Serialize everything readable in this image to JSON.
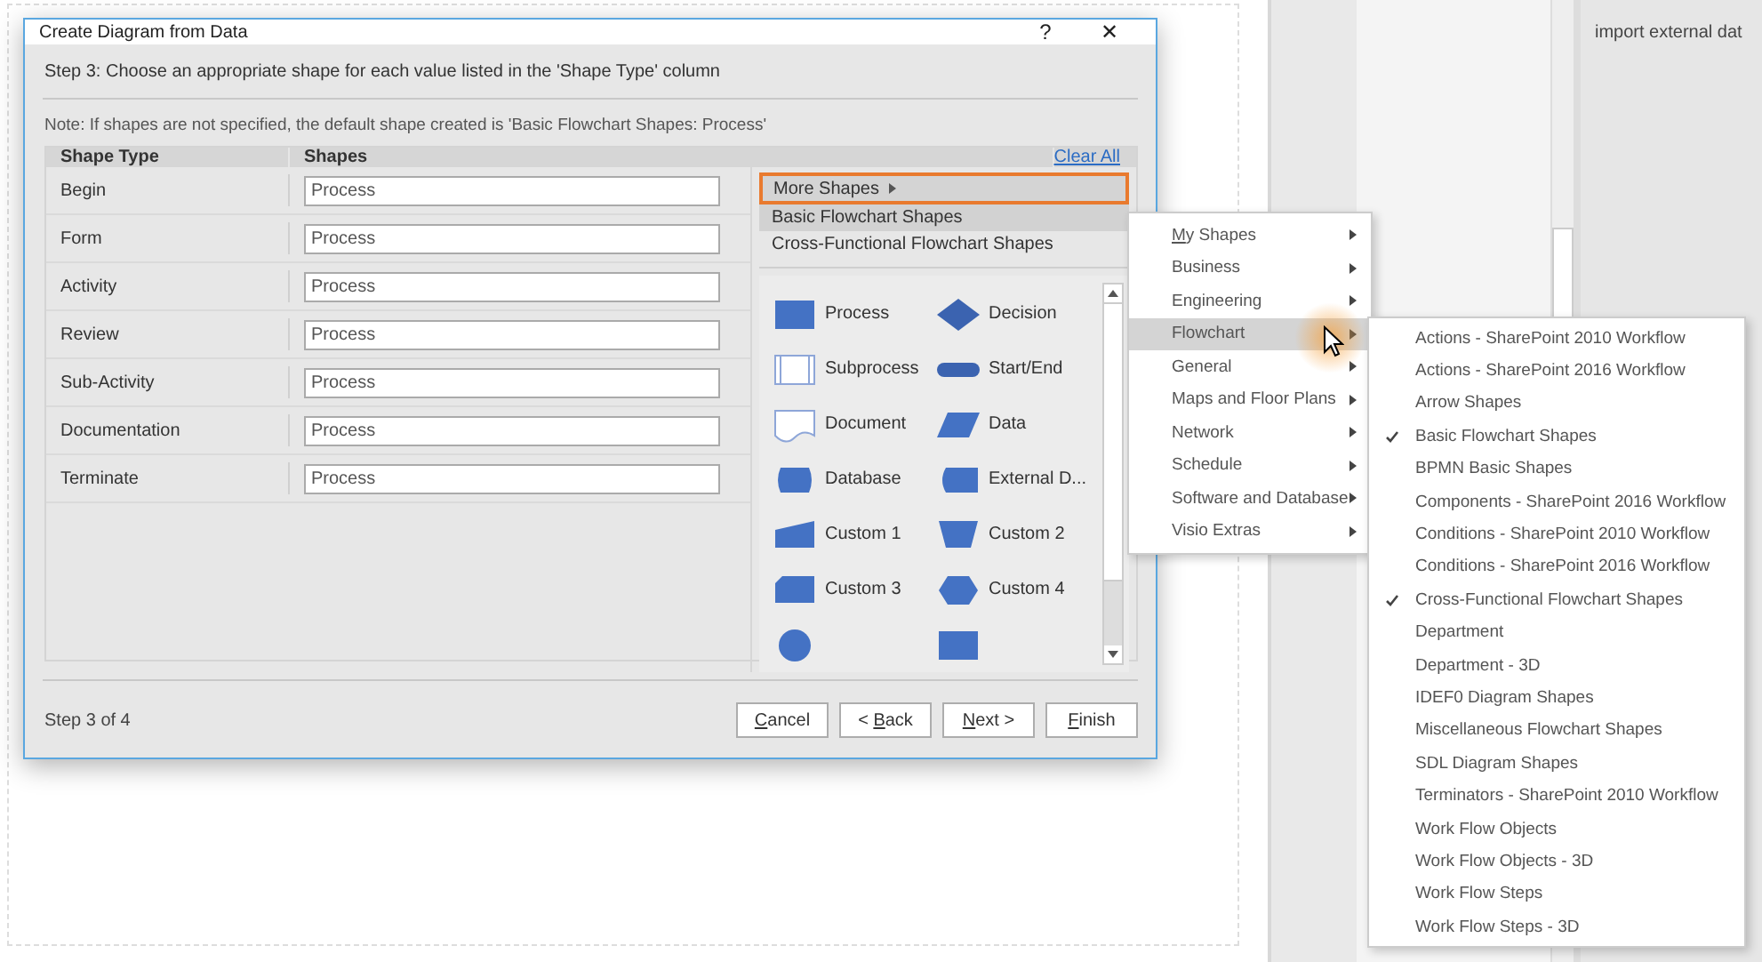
{
  "dialog": {
    "title": "Create Diagram from Data",
    "help": "?",
    "close": "✕",
    "step_heading": "Step 3: Choose an appropriate shape for each value listed in the 'Shape Type' column",
    "note": "Note: If shapes are not specified, the default shape created is 'Basic Flowchart Shapes: Process'",
    "table": {
      "columns": [
        "Shape Type",
        "Shapes"
      ],
      "clear_all": "Clear All",
      "rows": [
        {
          "type": "Begin",
          "shape": "Process"
        },
        {
          "type": "Form",
          "shape": "Process"
        },
        {
          "type": "Activity",
          "shape": "Process"
        },
        {
          "type": "Review",
          "shape": "Process"
        },
        {
          "type": "Sub-Activity",
          "shape": "Process"
        },
        {
          "type": "Documentation",
          "shape": "Process"
        },
        {
          "type": "Terminate",
          "shape": "Process"
        }
      ]
    },
    "more_shapes": "More Shapes",
    "stencils": [
      {
        "label": "Basic Flowchart Shapes",
        "selected": true
      },
      {
        "label": "Cross-Functional Flowchart Shapes",
        "selected": false
      }
    ],
    "shapes": [
      {
        "kind": "process",
        "label": "Process"
      },
      {
        "kind": "decision",
        "label": "Decision"
      },
      {
        "kind": "subprocess",
        "label": "Subprocess"
      },
      {
        "kind": "startend",
        "label": "Start/End"
      },
      {
        "kind": "document",
        "label": "Document"
      },
      {
        "kind": "data",
        "label": "Data"
      },
      {
        "kind": "database",
        "label": "Database"
      },
      {
        "kind": "external",
        "label": "External D..."
      },
      {
        "kind": "custom1",
        "label": "Custom 1"
      },
      {
        "kind": "custom2",
        "label": "Custom 2"
      },
      {
        "kind": "custom3",
        "label": "Custom 3"
      },
      {
        "kind": "custom4",
        "label": "Custom 4"
      },
      {
        "kind": "circle"
      },
      {
        "kind": "process"
      }
    ],
    "footer": "Step 3 of 4",
    "buttons": [
      {
        "key": "C",
        "after": "ancel"
      },
      {
        "before": "< ",
        "key": "B",
        "after": "ack"
      },
      {
        "key": "N",
        "after": "ext >"
      },
      {
        "key": "F",
        "after": "inish"
      }
    ]
  },
  "category_menu": [
    {
      "key": "M",
      "after": "y Shapes",
      "selected": false
    },
    {
      "before": "Business",
      "selected": false
    },
    {
      "before": "Engineering",
      "selected": false
    },
    {
      "before": "Flowchart",
      "selected": true
    },
    {
      "before": "General",
      "selected": false
    },
    {
      "before": "Maps and Floor Plans",
      "selected": false
    },
    {
      "before": "Network",
      "selected": false
    },
    {
      "before": "Schedule",
      "selected": false
    },
    {
      "before": "Software and Database",
      "selected": false
    },
    {
      "before": "Visio Extras",
      "selected": false
    }
  ],
  "stencil_menu": [
    {
      "label": "Actions - SharePoint 2010 Workflow",
      "checked": false
    },
    {
      "label": "Actions - SharePoint 2016 Workflow",
      "checked": false
    },
    {
      "label": "Arrow Shapes",
      "checked": false
    },
    {
      "label": "Basic Flowchart Shapes",
      "checked": true
    },
    {
      "label": "BPMN Basic Shapes",
      "checked": false
    },
    {
      "label": "Components - SharePoint 2016 Workflow",
      "checked": false
    },
    {
      "label": "Conditions - SharePoint 2010 Workflow",
      "checked": false
    },
    {
      "label": "Conditions - SharePoint 2016 Workflow",
      "checked": false
    },
    {
      "label": "Cross-Functional Flowchart Shapes",
      "checked": true
    },
    {
      "label": "Department",
      "checked": false
    },
    {
      "label": "Department - 3D",
      "checked": false
    },
    {
      "label": "IDEF0 Diagram Shapes",
      "checked": false
    },
    {
      "label": "Miscellaneous Flowchart Shapes",
      "checked": false
    },
    {
      "label": "SDL Diagram Shapes",
      "checked": false
    },
    {
      "label": "Terminators - SharePoint 2010 Workflow",
      "checked": false
    },
    {
      "label": "Work Flow Objects",
      "checked": false
    },
    {
      "label": "Work Flow Objects - 3D",
      "checked": false
    },
    {
      "label": "Work Flow Steps",
      "checked": false
    },
    {
      "label": "Work Flow Steps - 3D",
      "checked": false
    }
  ],
  "side_panel_text": "import external dat"
}
